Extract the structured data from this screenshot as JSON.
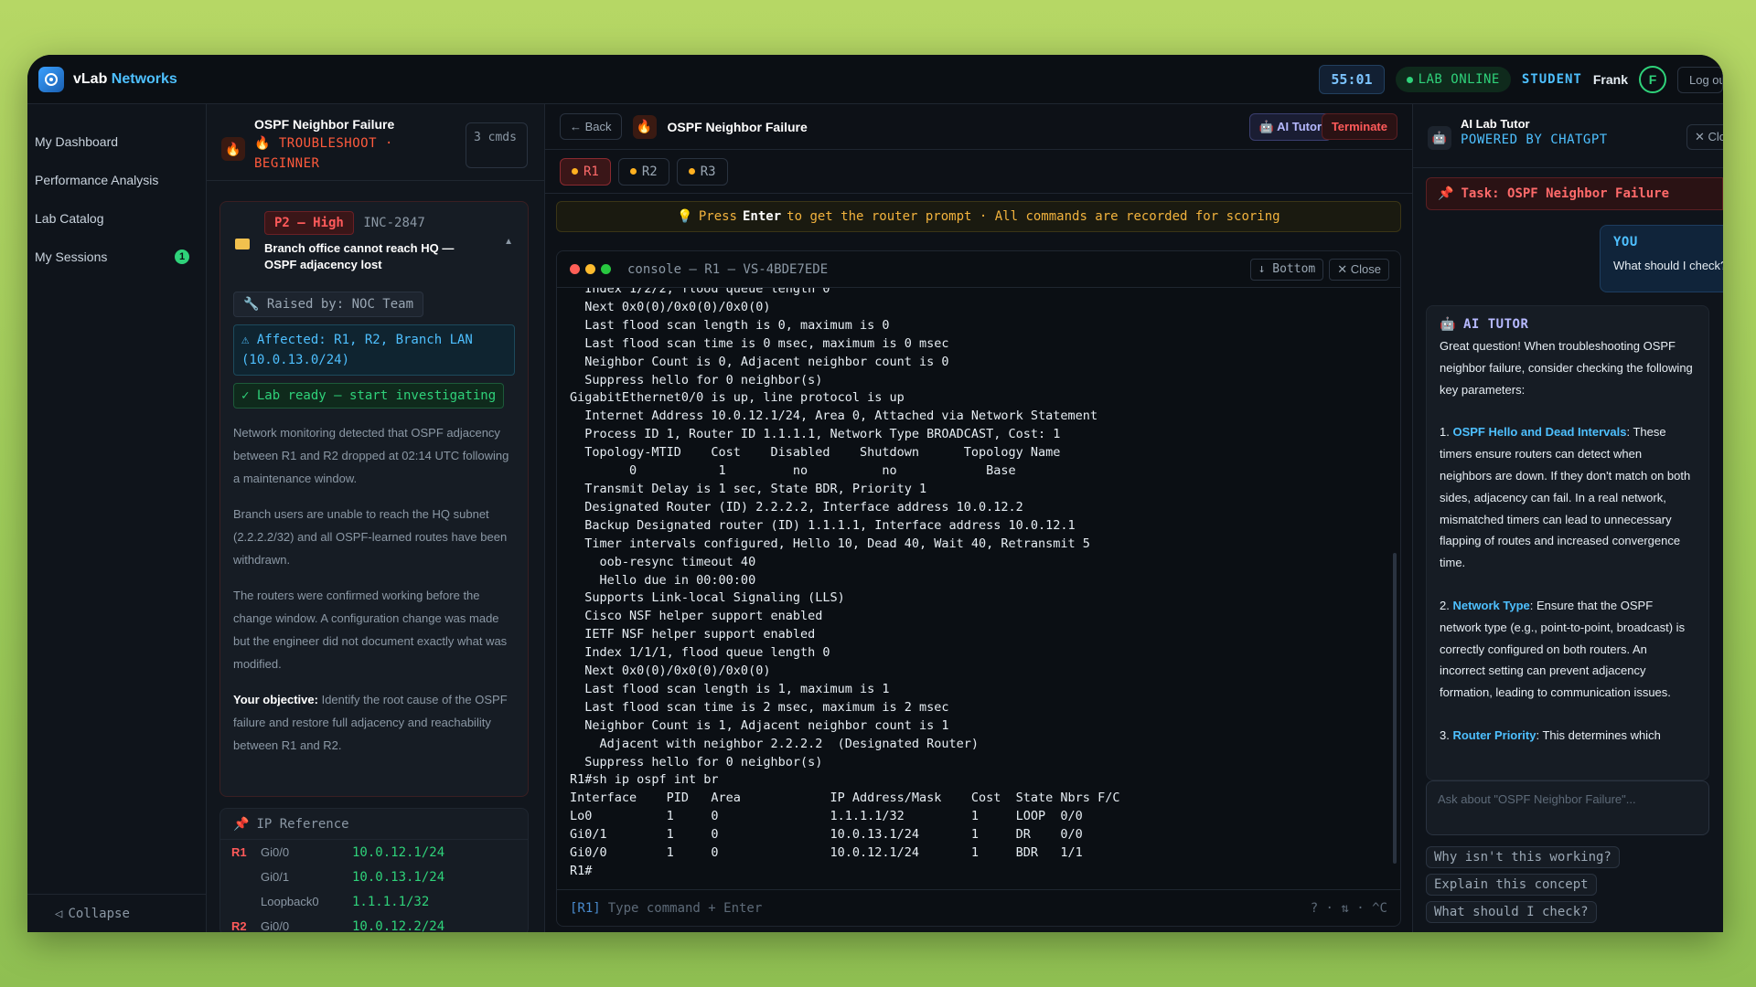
{
  "app": {
    "brand_a": "vLab",
    "brand_b": "Networks"
  },
  "topbar": {
    "timer": "55:01",
    "status": "LAB ONLINE",
    "role": "STUDENT",
    "user": "Frank",
    "avatar": "F",
    "logout": "Log out"
  },
  "nav": {
    "items": [
      {
        "label": "My Dashboard"
      },
      {
        "label": "Performance Analysis"
      },
      {
        "label": "Lab Catalog"
      },
      {
        "label": "My Sessions",
        "badge": "1"
      }
    ],
    "collapse": "Collapse"
  },
  "scenario": {
    "title": "OSPF Neighbor Failure",
    "subtitle": "TROUBLESHOOT · BEGINNER",
    "cmds": "3 cmds",
    "priority": "P2 — High",
    "incident_id": "INC-2847",
    "incident_title": "Branch office cannot reach HQ — OSPF adjacency lost",
    "raised_by": "Raised by: NOC Team",
    "affected": "Affected: R1, R2, Branch LAN (10.0.13.0/24)",
    "ready": "Lab ready — start investigating",
    "para1": "Network monitoring detected that OSPF adjacency between R1 and R2 dropped at 02:14 UTC following a maintenance window.",
    "para2": "Branch users are unable to reach the HQ subnet (2.2.2.2/32) and all OSPF-learned routes have been withdrawn.",
    "para3": "The routers were confirmed working before the change window. A configuration change was made but the engineer did not document exactly what was modified.",
    "objective_label": "Your objective:",
    "objective": "Identify the root cause of the OSPF failure and restore full adjacency and reachability between R1 and R2."
  },
  "ip_reference": {
    "title": "IP Reference",
    "rows": [
      {
        "router": "R1",
        "iface": "Gi0/0",
        "addr": "10.0.12.1/24"
      },
      {
        "router": "",
        "iface": "Gi0/1",
        "addr": "10.0.13.1/24"
      },
      {
        "router": "",
        "iface": "Loopback0",
        "addr": "1.1.1.1/32"
      },
      {
        "router": "R2",
        "iface": "Gi0/0",
        "addr": "10.0.12.2/24"
      }
    ]
  },
  "center": {
    "back": "Back",
    "title": "OSPF Neighbor Failure",
    "ai_tutor": "AI Tutor",
    "terminate": "Terminate",
    "tabs": [
      "R1",
      "R2",
      "R3"
    ],
    "hint_pre": "Press",
    "hint_key": "Enter",
    "hint_post": "to get the router prompt · All commands are recorded for scoring",
    "console_title": "console — R1 — VS-4BDE7EDE",
    "bottom_btn": "Bottom",
    "close_btn": "Close",
    "output": "  Index 1/2/2, flood queue length 0\n  Next 0x0(0)/0x0(0)/0x0(0)\n  Last flood scan length is 0, maximum is 0\n  Last flood scan time is 0 msec, maximum is 0 msec\n  Neighbor Count is 0, Adjacent neighbor count is 0\n  Suppress hello for 0 neighbor(s)\nGigabitEthernet0/0 is up, line protocol is up\n  Internet Address 10.0.12.1/24, Area 0, Attached via Network Statement\n  Process ID 1, Router ID 1.1.1.1, Network Type BROADCAST, Cost: 1\n  Topology-MTID    Cost    Disabled    Shutdown      Topology Name\n        0           1         no          no            Base\n  Transmit Delay is 1 sec, State BDR, Priority 1\n  Designated Router (ID) 2.2.2.2, Interface address 10.0.12.2\n  Backup Designated router (ID) 1.1.1.1, Interface address 10.0.12.1\n  Timer intervals configured, Hello 10, Dead 40, Wait 40, Retransmit 5\n    oob-resync timeout 40\n    Hello due in 00:00:00\n  Supports Link-local Signaling (LLS)\n  Cisco NSF helper support enabled\n  IETF NSF helper support enabled\n  Index 1/1/1, flood queue length 0\n  Next 0x0(0)/0x0(0)/0x0(0)\n  Last flood scan length is 1, maximum is 1\n  Last flood scan time is 2 msec, maximum is 2 msec\n  Neighbor Count is 1, Adjacent neighbor count is 1\n    Adjacent with neighbor 2.2.2.2  (Designated Router)\n  Suppress hello for 0 neighbor(s)\nR1#sh ip ospf int br\nInterface    PID   Area            IP Address/Mask    Cost  State Nbrs F/C\nLo0          1     0               1.1.1.1/32         1     LOOP  0/0\nGi0/1        1     0               10.0.13.1/24       1     DR    0/0\nGi0/0        1     0               10.0.12.1/24       1     BDR   1/1\nR1#",
    "prompt": "[R1]",
    "input_placeholder": "Type command + Enter",
    "keys": "? · ⇅ · ^C"
  },
  "tutor": {
    "title": "AI Lab Tutor",
    "subtitle": "POWERED BY CHATGPT",
    "close": "Close",
    "task": "Task: OSPF Neighbor Failure",
    "you_label": "YOU",
    "you_msg": "What should I check?",
    "ai_label": "AI TUTOR",
    "intro": "Great question! When troubleshooting OSPF neighbor failure, consider checking the following key parameters:",
    "p1_num": "1.",
    "p1_hl": "OSPF Hello and Dead Intervals",
    "p1": ": These timers ensure routers can detect when neighbors are down. If they don't match on both sides, adjacency can fail. In a real network, mismatched timers can lead to unnecessary flapping of routes and increased convergence time.",
    "p2_num": "2.",
    "p2_hl": "Network Type",
    "p2": ": Ensure that the OSPF network type (e.g., point-to-point, broadcast) is correctly configured on both routers. An incorrect setting can prevent adjacency formation, leading to communication issues.",
    "p3_num": "3.",
    "p3_hl": "Router Priority",
    "p3": ": This determines which",
    "ask_placeholder": "Ask about \"OSPF Neighbor Failure\"...",
    "chips": [
      "Why isn't this working?",
      "Explain this concept",
      "What should I check?"
    ]
  },
  "colors": {
    "accent": "#4ec0ff",
    "success": "#2fd27a",
    "danger": "#ff5a5a",
    "warning": "#f2b33d"
  }
}
